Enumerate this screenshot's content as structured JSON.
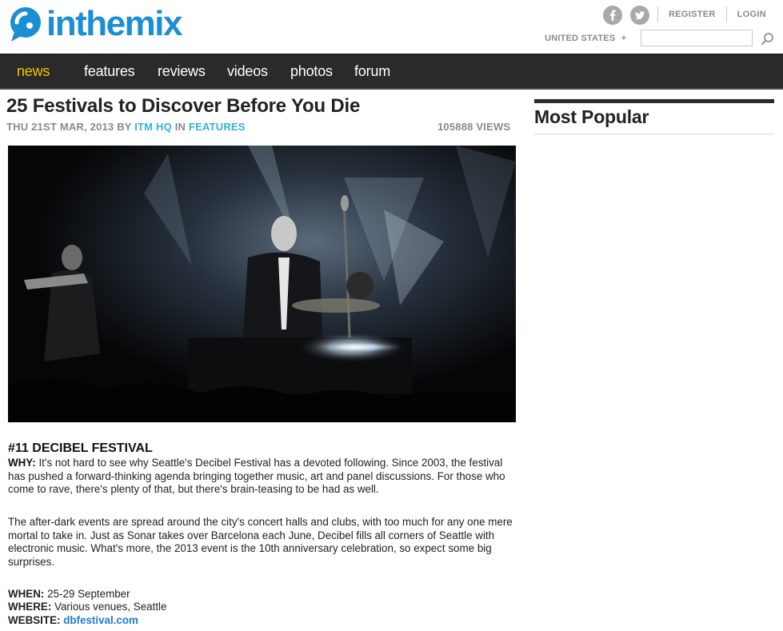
{
  "header": {
    "logo_text": "inthemix",
    "social": [
      "facebook-icon",
      "twitter-icon"
    ],
    "register_label": "REGISTER",
    "login_label": "LOGIN",
    "region_label": "UNITED STATES",
    "region_toggle": "+",
    "search": {
      "value": "",
      "placeholder": ""
    }
  },
  "colors": {
    "brand_blue": "#1b8ed4",
    "nav_bg": "#2a2a2a",
    "nav_active": "#f5c200",
    "link_teal": "#36b0d8",
    "link_blue": "#1e7ec8"
  },
  "nav": {
    "items": [
      {
        "label": "news",
        "active": true
      },
      {
        "label": "features",
        "active": false
      },
      {
        "label": "reviews",
        "active": false
      },
      {
        "label": "videos",
        "active": false
      },
      {
        "label": "photos",
        "active": false
      },
      {
        "label": "forum",
        "active": false
      }
    ]
  },
  "article": {
    "title": "25 Festivals to Discover Before You Die",
    "date": "THU 21ST MAR, 2013",
    "by": "BY",
    "author": "ITM HQ",
    "in": "IN",
    "category": "FEATURES",
    "views": "105888 VIEWS",
    "section_heading": "#11 DECIBEL FESTIVAL",
    "why_label": "WHY:",
    "why_text": "It's not hard to see why Seattle's Decibel Festival has a devoted following. Since 2003, the festival has pushed a forward-thinking agenda bringing together music, art and panel discussions. For those who come to rave, there's plenty of that, but there's brain-teasing to be had as well.",
    "para2": "The after-dark events are spread around the city's concert halls and clubs, with too much for any one mere mortal to take in. Just as Sonar takes over Barcelona each June, Decibel fills all corners of Seattle with electronic music. What's more, the 2013 event is the 10th anniversary celebration, so expect some big surprises.",
    "when_label": "WHEN:",
    "when_value": "25-29 September",
    "where_label": "WHERE:",
    "where_value": "Various venues, Seattle",
    "website_label": "WEBSITE:",
    "website_value": "dbfestival.com"
  },
  "sidebar": {
    "title": "Most Popular"
  }
}
